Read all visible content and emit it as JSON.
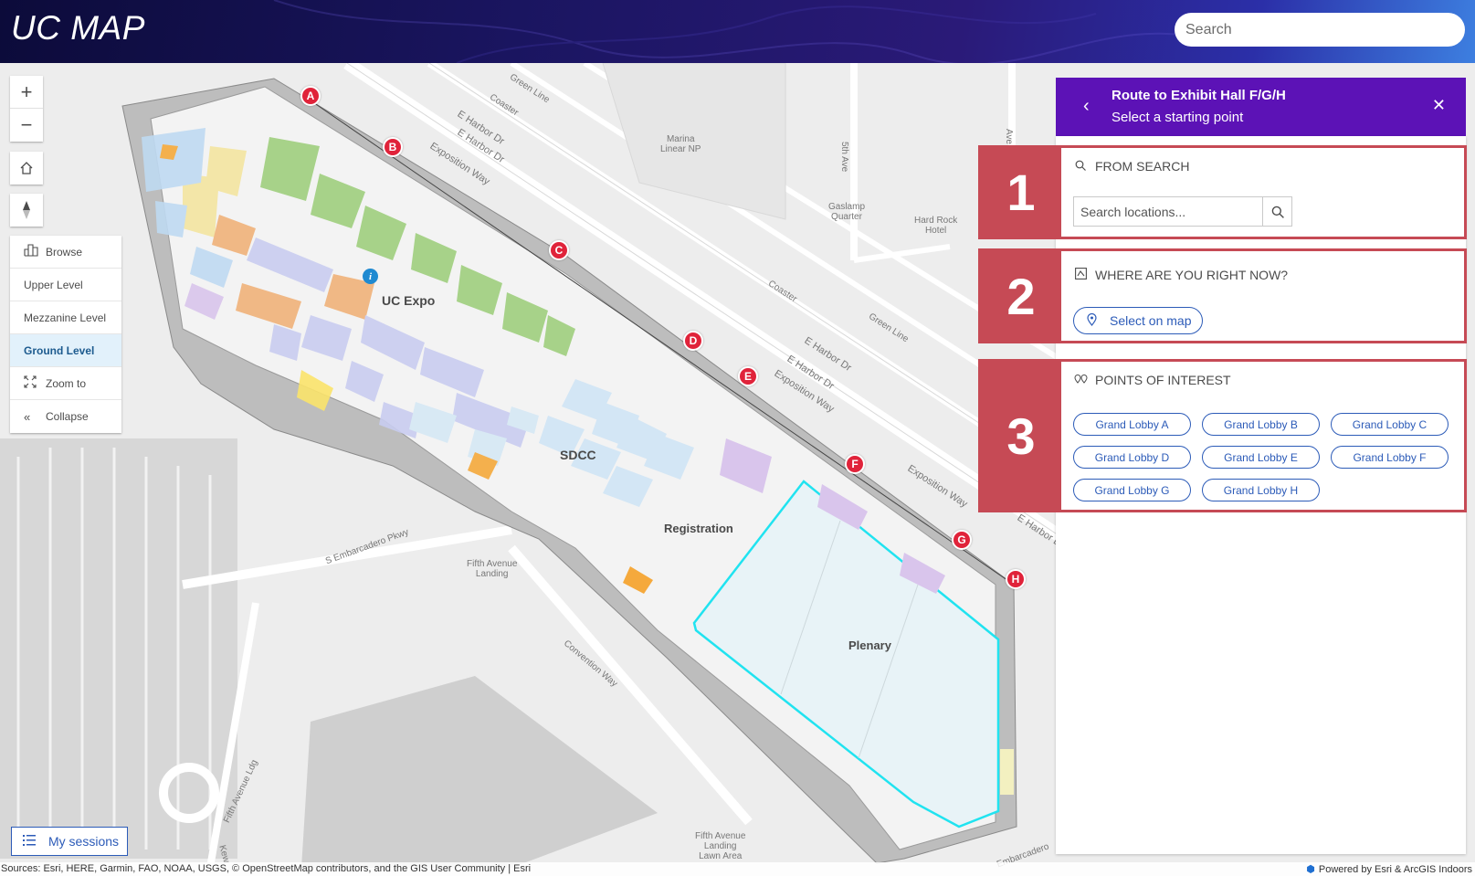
{
  "header": {
    "title": "UC MAP",
    "search_placeholder": "Search"
  },
  "map": {
    "labels": {
      "uc_expo": "UC Expo",
      "sdcc": "SDCC",
      "registration": "Registration",
      "plenary": "Plenary",
      "green_line_1": "Green Line",
      "green_line_2": "Green Line",
      "coaster_1": "Coaster",
      "coaster_2": "Coaster",
      "e_harbor_dr_1": "E Harbor Dr",
      "e_harbor_dr_2": "E Harbor Dr",
      "e_harbor_dr_3": "E Harbor Dr",
      "e_harbor_dr_4": "E Harbor Dr",
      "e_harbor_dr_5": "E Harbor Dr",
      "exposition_way_1": "Exposition Way",
      "exposition_way_2": "Exposition Way",
      "exposition_way_3": "Exposition Way",
      "marina_linear_np": "Marina\nLinear NP",
      "fifth_ave": "5th Ave",
      "gaslamp_quarter": "Gaslamp\nQuarter",
      "hard_rock_hotel": "Hard Rock\nHotel",
      "s_embarcadero_pkwy": "S Embarcadero Pkwy",
      "fifth_avenue_landing": "Fifth Avenue\nLanding",
      "convention_way": "Convention Way",
      "fifth_avenue_ldg": "Fifth Avenue Ldg",
      "fifth_avenue_landing_lawn": "Fifth Avenue\nLanding\nLawn Area",
      "embarcadero": "Embarcadero",
      "kew": "Kew",
      "ave": "Ave"
    },
    "markers": [
      "A",
      "B",
      "C",
      "D",
      "E",
      "F",
      "G",
      "H"
    ],
    "info_marker": "i",
    "highlight_color": "#20e3f0"
  },
  "tools": {
    "zoom_in": "+",
    "zoom_out": "−"
  },
  "levels": {
    "browse": "Browse",
    "upper": "Upper Level",
    "mezzanine": "Mezzanine Level",
    "ground": "Ground Level",
    "zoom_to": "Zoom to",
    "collapse": "Collapse",
    "active": "Ground Level"
  },
  "sessions": {
    "label": "My sessions"
  },
  "attribution": {
    "sources": "Sources: Esri, HERE, Garmin, FAO, NOAA, USGS, © OpenStreetMap contributors, and the GIS User Community | Esri",
    "powered": "Powered by Esri & ArcGIS Indoors"
  },
  "route": {
    "title": "Route to Exhibit Hall F/G/H",
    "subtitle": "Select a starting point",
    "accent": "#5c12b6",
    "step_color": "#c64a55"
  },
  "steps": {
    "one": {
      "number": "1",
      "heading": "FROM SEARCH",
      "placeholder": "Search locations..."
    },
    "two": {
      "number": "2",
      "heading": "WHERE ARE YOU RIGHT NOW?",
      "button": "Select on map"
    },
    "three": {
      "number": "3",
      "heading": "POINTS OF INTEREST",
      "items": [
        "Grand Lobby A",
        "Grand Lobby B",
        "Grand Lobby C",
        "Grand Lobby D",
        "Grand Lobby E",
        "Grand Lobby F",
        "Grand Lobby G",
        "Grand Lobby H"
      ]
    }
  }
}
